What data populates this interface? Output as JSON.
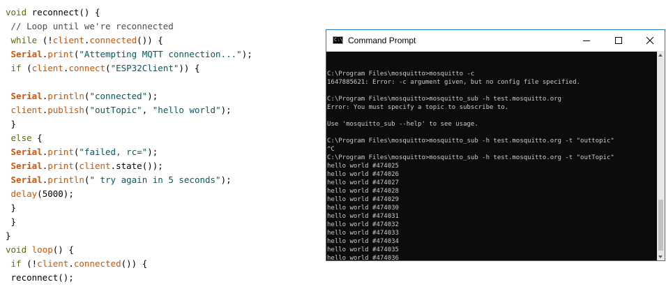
{
  "editor": {
    "lines": [
      [
        {
          "t": "void",
          "c": "kw"
        },
        {
          "t": " "
        },
        {
          "t": "reconnect",
          "c": "pl"
        },
        {
          "t": "() {"
        }
      ],
      [
        {
          "t": " // Loop until we're reconnected",
          "c": "cmt"
        }
      ],
      [
        {
          "t": " "
        },
        {
          "t": "while",
          "c": "kw"
        },
        {
          "t": " (!"
        },
        {
          "t": "client",
          "c": "obj"
        },
        {
          "t": "."
        },
        {
          "t": "connected",
          "c": "fn"
        },
        {
          "t": "()) {"
        }
      ],
      [
        {
          "t": " "
        },
        {
          "t": "Serial",
          "c": "cls"
        },
        {
          "t": "."
        },
        {
          "t": "print",
          "c": "fn"
        },
        {
          "t": "("
        },
        {
          "t": "\"Attempting MQTT connection...\"",
          "c": "str"
        },
        {
          "t": ");"
        }
      ],
      [
        {
          "t": " "
        },
        {
          "t": "if",
          "c": "kw"
        },
        {
          "t": " ("
        },
        {
          "t": "client",
          "c": "obj"
        },
        {
          "t": "."
        },
        {
          "t": "connect",
          "c": "fn"
        },
        {
          "t": "("
        },
        {
          "t": "\"ESP32Client\"",
          "c": "str"
        },
        {
          "t": ")) {"
        }
      ],
      [
        {
          "t": ""
        }
      ],
      [
        {
          "t": " "
        },
        {
          "t": "Serial",
          "c": "cls"
        },
        {
          "t": "."
        },
        {
          "t": "println",
          "c": "fn"
        },
        {
          "t": "("
        },
        {
          "t": "\"connected\"",
          "c": "str"
        },
        {
          "t": ");"
        }
      ],
      [
        {
          "t": " "
        },
        {
          "t": "client",
          "c": "obj"
        },
        {
          "t": "."
        },
        {
          "t": "publish",
          "c": "fn"
        },
        {
          "t": "("
        },
        {
          "t": "\"outTopic\"",
          "c": "str"
        },
        {
          "t": ", "
        },
        {
          "t": "\"hello world\"",
          "c": "str"
        },
        {
          "t": ");"
        }
      ],
      [
        {
          "t": " }"
        }
      ],
      [
        {
          "t": " "
        },
        {
          "t": "else",
          "c": "kw"
        },
        {
          "t": " {"
        }
      ],
      [
        {
          "t": " "
        },
        {
          "t": "Serial",
          "c": "cls"
        },
        {
          "t": "."
        },
        {
          "t": "print",
          "c": "fn"
        },
        {
          "t": "("
        },
        {
          "t": "\"failed, rc=\"",
          "c": "str"
        },
        {
          "t": ");"
        }
      ],
      [
        {
          "t": " "
        },
        {
          "t": "Serial",
          "c": "cls"
        },
        {
          "t": "."
        },
        {
          "t": "print",
          "c": "fn"
        },
        {
          "t": "("
        },
        {
          "t": "client",
          "c": "obj"
        },
        {
          "t": ".state());"
        }
      ],
      [
        {
          "t": " "
        },
        {
          "t": "Serial",
          "c": "cls"
        },
        {
          "t": "."
        },
        {
          "t": "println",
          "c": "fn"
        },
        {
          "t": "("
        },
        {
          "t": "\" try again in 5 seconds\"",
          "c": "str"
        },
        {
          "t": ");"
        }
      ],
      [
        {
          "t": " "
        },
        {
          "t": "delay",
          "c": "fn"
        },
        {
          "t": "(5000);"
        }
      ],
      [
        {
          "t": " }"
        }
      ],
      [
        {
          "t": " }"
        }
      ],
      [
        {
          "t": "}"
        }
      ],
      [
        {
          "t": "void",
          "c": "kw"
        },
        {
          "t": " "
        },
        {
          "t": "loop",
          "c": "fn"
        },
        {
          "t": "() {"
        }
      ],
      [
        {
          "t": " "
        },
        {
          "t": "if",
          "c": "kw"
        },
        {
          "t": " (!"
        },
        {
          "t": "client",
          "c": "obj"
        },
        {
          "t": "."
        },
        {
          "t": "connected",
          "c": "fn"
        },
        {
          "t": "()) {"
        }
      ],
      [
        {
          "t": " reconnect();"
        }
      ]
    ]
  },
  "cmd": {
    "title": "Command Prompt",
    "icon": "cmd-app-icon",
    "icon_text": "C:\\",
    "controls": {
      "minimize": "minimize-icon",
      "maximize": "maximize-icon",
      "close": "close-icon"
    },
    "lines": [
      "",
      "",
      "C:\\Program Files\\mosquitto>mosquitto -c",
      "1647885621: Error: -c argument given, but no config file specified.",
      "",
      "C:\\Program Files\\mosquitto>mosquitto_sub -h test.mosquitto.org",
      "Error: You must specify a topic to subscribe to.",
      "",
      "Use 'mosquitto_sub --help' to see usage.",
      "",
      "C:\\Program Files\\mosquitto>mosquitto_sub -h test.mosquitto.org -t \"outtopic\"",
      "^C",
      "C:\\Program Files\\mosquitto>mosquitto_sub -h test.mosquitto.org -t \"outTopic\"",
      "hello world #474025",
      "hello world #474026",
      "hello world #474027",
      "hello world #474028",
      "hello world #474029",
      "hello world #474030",
      "hello world #474031",
      "hello world #474032",
      "hello world #474033",
      "hello world #474034",
      "hello world #474035",
      "hello world #474036"
    ]
  },
  "colors": {
    "keyword": "#5e6d03",
    "function": "#d35400",
    "string": "#005c5f",
    "comment": "#434f54",
    "console_bg": "#0c0c0c",
    "console_fg": "#cccccc",
    "window_border": "#1979ca"
  }
}
